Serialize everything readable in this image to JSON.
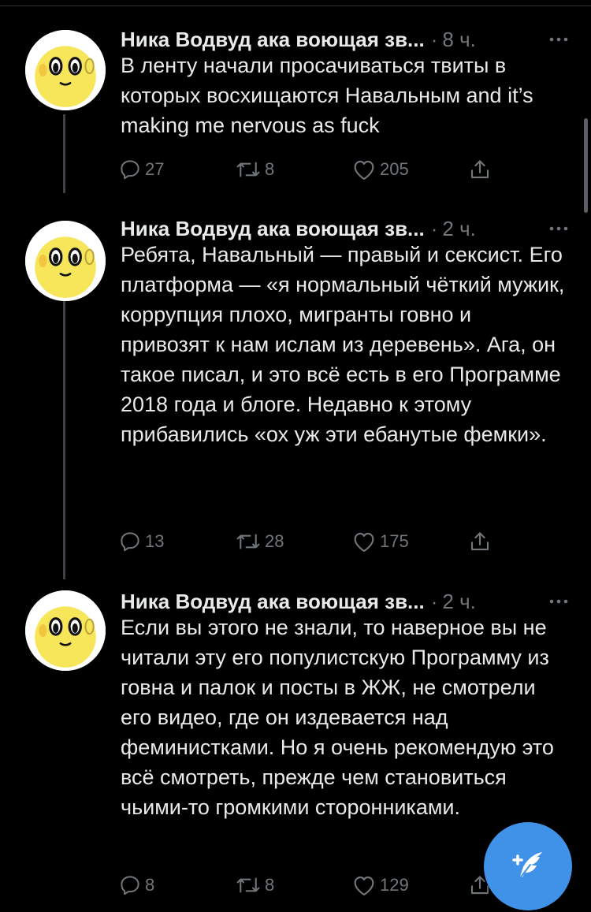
{
  "tweets": [
    {
      "author": "Ника Водвуд ака воющая зв...",
      "separator": "·",
      "time": "8 ч.",
      "text": "В ленту начали просачиваться твиты в которых восхищаются Навальным and it’s making me nervous as fuck",
      "replies": "27",
      "retweets": "8",
      "likes": "205"
    },
    {
      "author": "Ника Водвуд ака воющая зв...",
      "separator": "·",
      "time": "2 ч.",
      "text": "Ребята, Навальный — правый и сексист. Его платформа — «я нормальный чёткий мужик, коррупция плохо, мигранты говно и привозят к нам ислам из деревень». Ага, он такое писал, и это всё есть в его Программе 2018 года и блоге. Недавно к этому прибавились «ох уж эти ебанутые фемки».",
      "replies": "13",
      "retweets": "28",
      "likes": "175"
    },
    {
      "author": "Ника Водвуд ака воющая зв...",
      "separator": "·",
      "time": "2 ч.",
      "text": "Если вы этого не знали, то наверное вы не читали эту его популистскую Программу из говна и палок и посты в ЖЖ, не смотрели его видео, где он издевается над феминистками. Но я очень рекомендую это всё смотреть, прежде чем становиться чьими-то громкими сторонниками.",
      "replies": "8",
      "retweets": "8",
      "likes": "129"
    }
  ],
  "colors": {
    "background": "#000000",
    "text": "#e7e9ea",
    "muted": "#71767b",
    "thread_line": "#3d4246",
    "compose_button": "#3f92e8",
    "avatar_yellow": "#f7e55a"
  },
  "icons": {
    "reply": "speech-bubble-icon",
    "retweet": "retweet-arrows-icon",
    "like": "heart-outline-icon",
    "share": "share-upload-icon",
    "more": "three-dots-icon",
    "compose": "feather-plus-icon"
  }
}
